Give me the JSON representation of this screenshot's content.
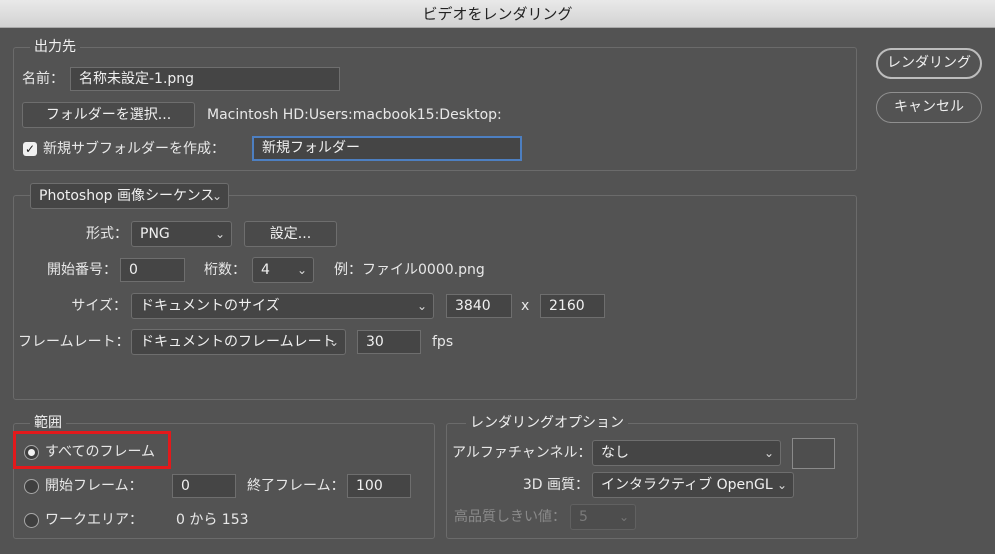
{
  "window": {
    "title": "ビデオをレンダリング"
  },
  "actions": {
    "render_label": "レンダリング",
    "cancel_label": "キャンセル"
  },
  "output": {
    "legend": "出力先",
    "name_label": "名前：",
    "name_value": "名称未設定-1.png",
    "select_folder_label": "フォルダーを選択...",
    "folder_path": "Macintosh HD:Users:macbook15:Desktop:",
    "subfolder_checkbox_label": "新規サブフォルダーを作成：",
    "subfolder_checked": true,
    "subfolder_value": "新規フォルダー"
  },
  "sequence": {
    "mode_value": "Photoshop 画像シーケンス",
    "format_label": "形式：",
    "format_value": "PNG",
    "settings_label": "設定...",
    "start_number_label": "開始番号：",
    "start_number_value": "0",
    "digits_label": "桁数：",
    "digits_value": "4",
    "example_text": "例：ファイル0000.png",
    "size_label": "サイズ：",
    "size_value": "ドキュメントのサイズ",
    "width_value": "3840",
    "x_separator": "x",
    "height_value": "2160",
    "framerate_label": "フレームレート：",
    "framerate_value": "ドキュメントのフレームレート",
    "fps_value": "30",
    "fps_unit": "fps"
  },
  "range": {
    "legend": "範囲",
    "all_frames_label": "すべてのフレーム",
    "all_frames_selected": true,
    "start_frame_label": "開始フレーム：",
    "start_frame_value": "0",
    "end_frame_label": "終了フレーム：",
    "end_frame_value": "100",
    "work_area_label": "ワークエリア：",
    "work_area_value": "0 から 153"
  },
  "render_options": {
    "legend": "レンダリングオプション",
    "alpha_label": "アルファチャンネル：",
    "alpha_value": "なし",
    "quality_label": "3D 画質：",
    "quality_value": "インタラクティブ OpenGL",
    "threshold_label": "高品質しきい値：",
    "threshold_value": "5"
  },
  "colors": {
    "highlight": "#e3191b",
    "focus": "#4d7fc1",
    "background": "#535353"
  },
  "icons": {
    "dropdown": "chevron-down-icon",
    "checkbox": "checkmark-icon"
  }
}
